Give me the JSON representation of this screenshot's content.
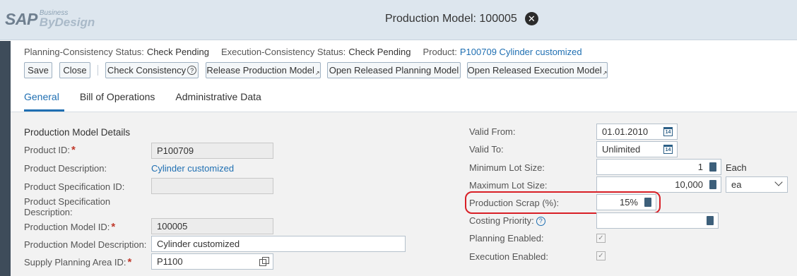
{
  "header": {
    "logo_sap": "SAP",
    "logo_business": "Business",
    "logo_bydesign": "ByDesign",
    "title": "Production Model: 100005",
    "close_glyph": "✕"
  },
  "status": {
    "planning_label": "Planning-Consistency Status:",
    "planning_value": "Check Pending",
    "execution_label": "Execution-Consistency Status:",
    "execution_value": "Check Pending",
    "product_label": "Product:",
    "product_value": "P100709 Cylinder customized"
  },
  "toolbar": {
    "save": "Save",
    "close": "Close",
    "check_consistency": "Check Consistency",
    "release": "Release Production Model",
    "open_planning": "Open Released Planning Model",
    "open_execution": "Open Released Execution Model"
  },
  "tabs": [
    "General",
    "Bill of Operations",
    "Administrative Data"
  ],
  "details": {
    "section_title": "Production Model Details",
    "product_id_label": "Product ID:",
    "product_id": "P100709",
    "product_desc_label": "Product Description:",
    "product_desc": "Cylinder customized",
    "product_spec_id_label": "Product Specification ID:",
    "product_spec_id": "",
    "product_spec_desc_label_1": "Product Specification",
    "product_spec_desc_label_2": "Description:",
    "model_id_label": "Production Model ID:",
    "model_id": "100005",
    "model_desc_label": "Production Model Description:",
    "model_desc": "Cylinder customized",
    "supply_area_label": "Supply Planning Area ID:",
    "supply_area": "P1100"
  },
  "right": {
    "valid_from_label": "Valid From:",
    "valid_from": "01.01.2010",
    "valid_to_label": "Valid To:",
    "valid_to": "Unlimited",
    "min_lot_label": "Minimum Lot Size:",
    "min_lot": "1",
    "min_lot_unit": "Each",
    "max_lot_label": "Maximum Lot Size:",
    "max_lot": "10,000",
    "max_lot_unit": "ea",
    "scrap_label": "Production Scrap (%):",
    "scrap": "15%",
    "costing_label": "Costing Priority:",
    "costing": "",
    "planning_enabled_label": "Planning Enabled:",
    "execution_enabled_label": "Execution Enabled:",
    "cal_glyph": "14",
    "check_glyph": "✓",
    "help_glyph": "?"
  }
}
